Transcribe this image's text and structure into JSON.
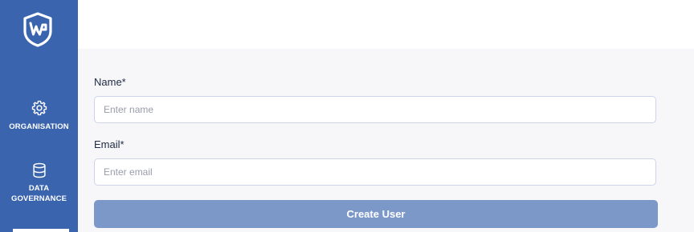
{
  "sidebar": {
    "background": "#3a64ae",
    "logo_icon": "shield-w-logo-icon",
    "items": [
      {
        "label": "ORGANISATION",
        "icon": "gear-icon"
      },
      {
        "label_line1": "DATA",
        "label_line2": "GOVERNANCE",
        "icon": "database-icon"
      }
    ]
  },
  "form": {
    "name_label": "Name*",
    "name_placeholder": "Enter name",
    "name_value": "",
    "email_label": "Email*",
    "email_placeholder": "Enter email",
    "email_value": "",
    "submit_label": "Create User",
    "submit_color": "#7b98c9"
  }
}
